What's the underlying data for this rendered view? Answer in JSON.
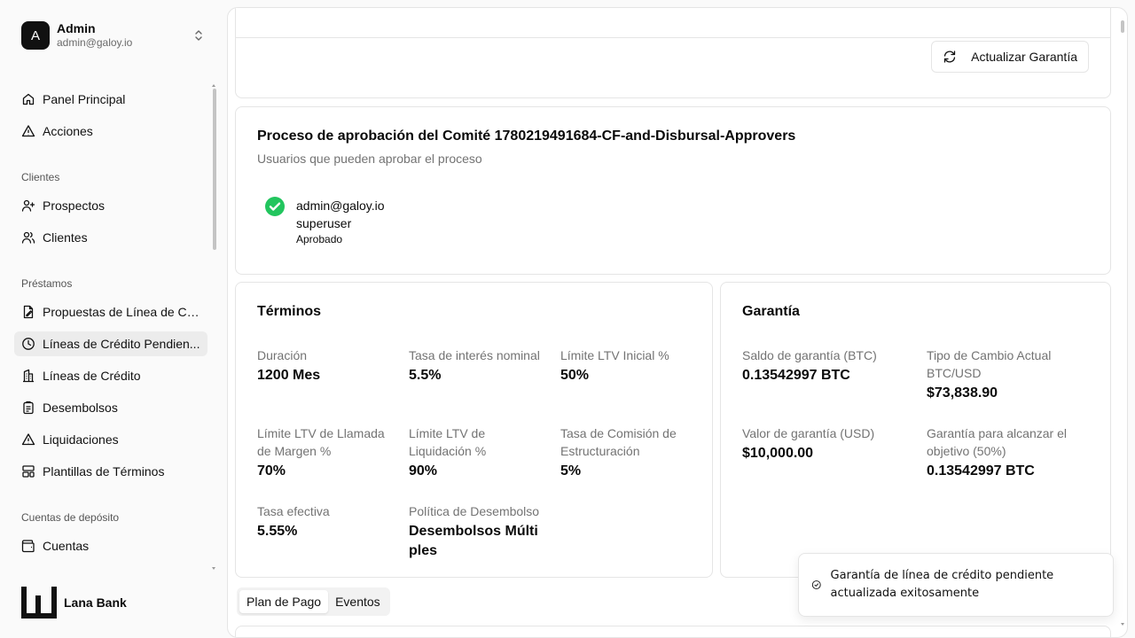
{
  "user": {
    "initial": "A",
    "name": "Admin",
    "email": "admin@galoy.io"
  },
  "nav": {
    "top": [
      {
        "label": "Panel Principal",
        "icon": "home-icon"
      },
      {
        "label": "Acciones",
        "icon": "alert-triangle-icon"
      }
    ],
    "clientes": {
      "label": "Clientes",
      "items": [
        {
          "label": "Prospectos",
          "icon": "user-plus-icon"
        },
        {
          "label": "Clientes",
          "icon": "users-icon"
        }
      ]
    },
    "prestamos": {
      "label": "Préstamos",
      "items": [
        {
          "label": "Propuestas de Línea de Cr...",
          "icon": "file-edit-icon"
        },
        {
          "label": "Líneas de Crédito Pendien...",
          "icon": "clock-icon"
        },
        {
          "label": "Líneas de Crédito",
          "icon": "building-icon"
        },
        {
          "label": "Desembolsos",
          "icon": "clipboard-list-icon"
        },
        {
          "label": "Liquidaciones",
          "icon": "alert-triangle-icon"
        },
        {
          "label": "Plantillas de Términos",
          "icon": "layout-template-icon"
        }
      ]
    },
    "deposito": {
      "label": "Cuentas de depósito",
      "items": [
        {
          "label": "Cuentas",
          "icon": "wallet-icon"
        }
      ]
    }
  },
  "brand": {
    "name": "Lana Bank"
  },
  "collateral_update": {
    "button_label": "Actualizar Garantía"
  },
  "approval": {
    "title": "Proceso de aprobación del Comité 1780219491684-CF-and-Disbursal-Approvers",
    "subtitle": "Usuarios que pueden aprobar el proceso",
    "approver": {
      "email": "admin@galoy.io",
      "role": "superuser",
      "status": "Aprobado"
    }
  },
  "terms": {
    "title": "Términos",
    "duration_label": "Duración",
    "duration_value": "1200 Mes",
    "rate_label": "Tasa de interés nominal",
    "rate_value": "5.5%",
    "initial_ltv_label": "Límite LTV Inicial %",
    "initial_ltv_value": "50%",
    "margin_call_label": "Límite LTV de Llamada de Margen %",
    "margin_call_value": "70%",
    "liquidation_label": "Límite LTV de Liquidación %",
    "liquidation_value": "90%",
    "fee_label": "Tasa de Comisión de Estructuración",
    "fee_value": "5%",
    "effective_label": "Tasa efectiva",
    "effective_value": "5.55%",
    "disbursal_label": "Política de Desembolso",
    "disbursal_value": "Desembolsos Múltiples"
  },
  "collateral": {
    "title": "Garantía",
    "balance_label": "Saldo de garantía (BTC)",
    "balance_value": "0.13542997 BTC",
    "rate_label": "Tipo de Cambio Actual BTC/USD",
    "rate_value": "$73,838.90",
    "usd_label": "Valor de garantía (USD)",
    "usd_value": "$10,000.00",
    "target_label": "Garantía para alcanzar el objetivo (50%)",
    "target_value": "0.13542997 BTC"
  },
  "tabs": [
    {
      "label": "Plan de Pago",
      "active": true
    },
    {
      "label": "Eventos",
      "active": false
    }
  ],
  "toast": {
    "message": "Garantía de línea de crédito pendiente actualizada exitosamente"
  }
}
